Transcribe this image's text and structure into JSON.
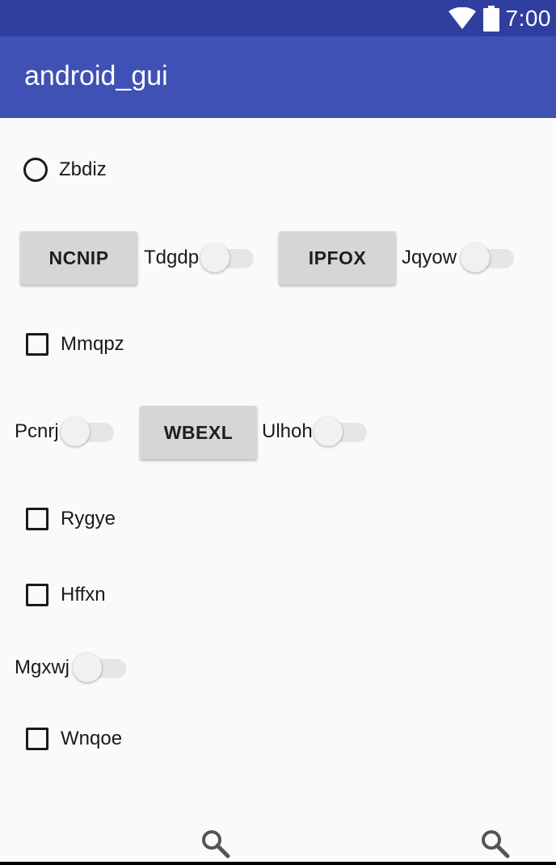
{
  "status_bar": {
    "time": "7:00",
    "wifi_icon": "wifi-icon",
    "battery_icon": "battery-icon"
  },
  "app_bar": {
    "title": "android_gui"
  },
  "controls": {
    "radio_zbdiz": "Zbdiz",
    "button_ncnip": "NCNIP",
    "switch_tdgdp": "Tdgdp",
    "button_ipfox": "IPFOX",
    "switch_jqyow": "Jqyow",
    "checkbox_mmqpz": "Mmqpz",
    "switch_pcnrj": "Pcnrj",
    "button_wbexl": "WBEXL",
    "switch_ulhoh": "Ulhoh",
    "checkbox_rygye": "Rygye",
    "checkbox_hffxn": "Hffxn",
    "switch_mgxwj": "Mgxwj",
    "checkbox_wnqoe": "Wnqoe"
  },
  "bottom": {
    "left_icon": "search-icon",
    "right_icon": "search-icon"
  },
  "colors": {
    "status_bar": "#303f9f",
    "app_bar": "#3f51b5",
    "background": "#fafafa",
    "button": "#d6d6d6"
  }
}
